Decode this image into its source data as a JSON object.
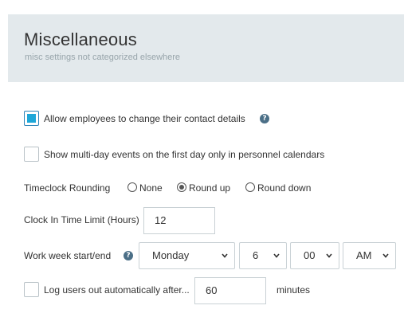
{
  "header": {
    "title": "Miscellaneous",
    "subtitle": "misc settings not categorized elsewhere"
  },
  "settings": {
    "allow_contact_change": {
      "label": "Allow employees to change their contact details",
      "checked": true,
      "help_icon": "question-circle-icon"
    },
    "multi_day_events": {
      "label": "Show multi-day events on the first day only in personnel calendars",
      "checked": false
    },
    "timeclock_rounding": {
      "label": "Timeclock Rounding",
      "options": [
        "None",
        "Round up",
        "Round down"
      ],
      "selected": "Round up"
    },
    "clock_in_limit": {
      "label": "Clock In Time Limit (Hours)",
      "value": "12"
    },
    "work_week": {
      "label": "Work week start/end",
      "help_icon": "question-circle-icon",
      "day": "Monday",
      "hour": "6",
      "minute": "00",
      "ampm": "AM"
    },
    "auto_logout": {
      "label": "Log users out automatically after...",
      "value": "60",
      "unit": "minutes",
      "checked": false
    }
  }
}
